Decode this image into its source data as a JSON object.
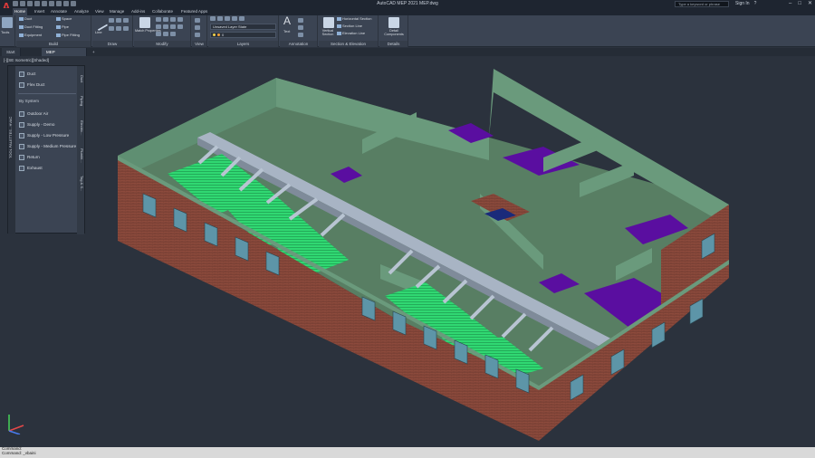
{
  "titlebar": {
    "logo": "A",
    "app_title": "AutoCAD MEP 2021   MEP.dwg",
    "search_placeholder": "Type a keyword or phrase",
    "sign_in": "Sign In",
    "help": "?",
    "minimize": "–",
    "maximize": "□",
    "close": "✕"
  },
  "tabs": [
    "Home",
    "Insert",
    "Annotate",
    "Analyze",
    "View",
    "Manage",
    "Add-ins",
    "Collaborate",
    "Featured Apps"
  ],
  "ribbon": {
    "tools_label": "Tools",
    "build": {
      "label": "Build",
      "items": [
        "Duct",
        "Duct Fitting",
        "Equipment",
        "Space",
        "Pipe",
        "Pipe Fitting"
      ]
    },
    "draw": {
      "label": "Draw",
      "line": "Line"
    },
    "modify": {
      "label": "Modify",
      "match": "Match Properties"
    },
    "view": {
      "label": "View"
    },
    "layers": {
      "label": "Layers",
      "state": "Unsaved Layer State",
      "current": "0"
    },
    "annotation": {
      "label": "Annotation",
      "text": "Text"
    },
    "section": {
      "label": "Section & Elevation",
      "vertical": "Vertical Section",
      "items": [
        "Horizontal Section",
        "Section Line",
        "Elevation Line"
      ]
    },
    "details": {
      "label": "Details",
      "component": "Detail Components"
    }
  },
  "file_tabs": [
    "Start",
    "MEP"
  ],
  "viewport_label": "[-][SE Isometric][Shaded]",
  "palette": {
    "title": "TOOL PALETTES - HVAC",
    "items_top": [
      "Duct",
      "Flex Duct"
    ],
    "section": "By System",
    "items_system": [
      "Outdoor Air",
      "Supply - Demo",
      "Supply - Low Pressure",
      "Supply - Medium Pressure",
      "Return",
      "Exhaust"
    ],
    "side_tabs": [
      "Duct",
      "Piping",
      "Electric...",
      "Plumbi...",
      "Tag & S..."
    ]
  },
  "command": {
    "line1": "Command:",
    "line2": "Command:  _vbaini"
  },
  "colors": {
    "ribbon_bg": "#3b4453",
    "titlebar_bg": "#1e2530",
    "canvas_bg": "#2b323d",
    "brick": "#8c4a3c",
    "wall": "#5e8d70",
    "floor": "#5a7e64",
    "purple_floor": "#5a0ea0",
    "green_duct": "#35e07a",
    "duct_metal": "#a8b4c4"
  }
}
